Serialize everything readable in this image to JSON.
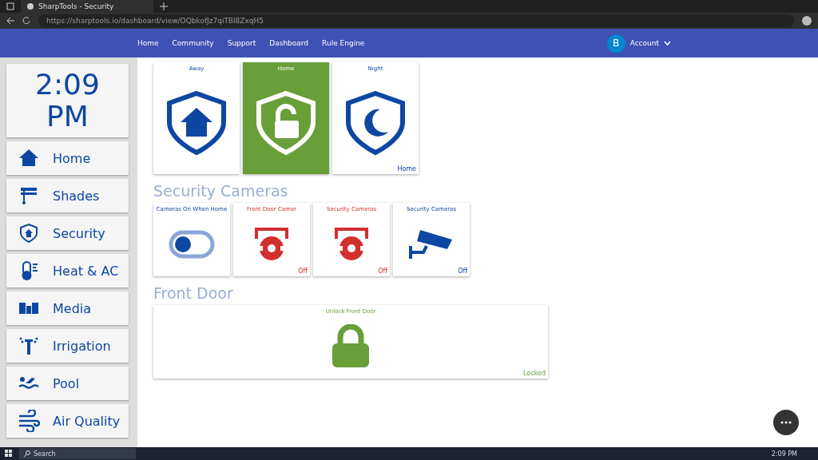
{
  "browser": {
    "tab_title": "SharpTools - Security",
    "url": "https://sharptools.io/dashboard/view/OQbkofJz7qiTBl8ZxqH5"
  },
  "nav": {
    "links": [
      "Home",
      "Community",
      "Support",
      "Dashboard",
      "Rule Engine"
    ],
    "account": {
      "initial": "B",
      "label": "Account"
    }
  },
  "sidebar": {
    "clock": {
      "time": "2:09",
      "period": "PM"
    },
    "items": [
      {
        "label": "Home",
        "kind": "house"
      },
      {
        "label": "Shades",
        "kind": "shades"
      },
      {
        "label": "Security",
        "kind": "shield"
      },
      {
        "label": "Heat & AC",
        "kind": "thermometer"
      },
      {
        "label": "Media",
        "kind": "speakers"
      },
      {
        "label": "Irrigation",
        "kind": "sprinkler"
      },
      {
        "label": "Pool",
        "kind": "swimmer"
      },
      {
        "label": "Air Quality",
        "kind": "wind"
      }
    ]
  },
  "modes": [
    {
      "label": "Away",
      "kind": "away",
      "selected": false
    },
    {
      "label": "Home",
      "kind": "home",
      "selected": true
    },
    {
      "label": "Night",
      "kind": "night",
      "selected": false,
      "status": "Home"
    }
  ],
  "sections": [
    {
      "title": "Security Cameras",
      "tiles": [
        {
          "kind": "switch",
          "label": "Cameras On When Home",
          "on": false
        },
        {
          "kind": "camera",
          "label": "Front Door Camer",
          "alert": true,
          "status": "Off"
        },
        {
          "kind": "camera",
          "label": "Security Cameras",
          "alert": true,
          "status": "Off"
        },
        {
          "kind": "camera",
          "label": "Security Cameras",
          "alert": false,
          "status": "Off"
        }
      ]
    },
    {
      "title": "Front Door",
      "tiles": [
        {
          "kind": "lock",
          "label": "Unlock Front Door",
          "locked": true,
          "status": "Locked"
        }
      ]
    }
  ],
  "taskbar": {
    "search": "Search",
    "time": "2:09 PM"
  }
}
